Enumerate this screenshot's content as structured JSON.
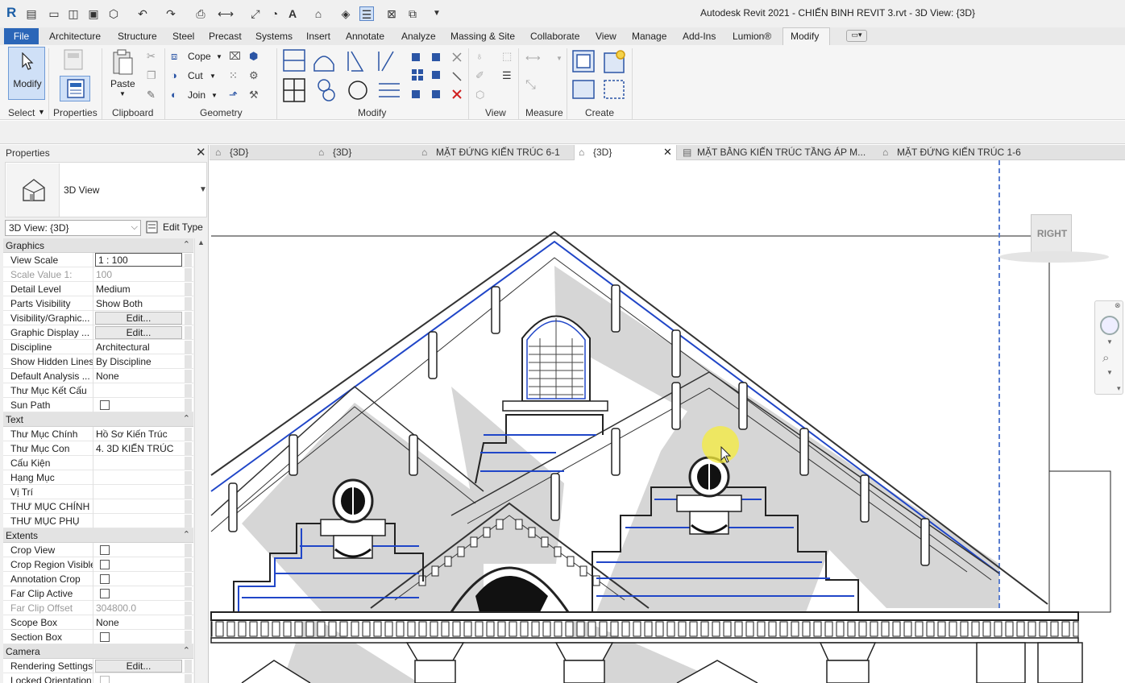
{
  "app": {
    "title": "Autodesk Revit 2021 - CHIẾN BINH REVIT 3.rvt - 3D View: {3D}",
    "logo": "R"
  },
  "quick_access": [
    "revit-logo",
    "open-icon",
    "new-icon",
    "folder-icon",
    "save-icon",
    "sync-icon",
    "undo-icon",
    "redo-icon",
    "print-icon",
    "measure-icon",
    "dimension-icon",
    "tag-icon",
    "text-icon",
    "3d-icon",
    "section-icon",
    "thin-lines-icon",
    "close-hidden-icon",
    "switch-windows-icon",
    "customize-icon"
  ],
  "menu": {
    "file": "File",
    "tabs": [
      "Architecture",
      "Structure",
      "Steel",
      "Precast",
      "Systems",
      "Insert",
      "Annotate",
      "Analyze",
      "Massing & Site",
      "Collaborate",
      "View",
      "Manage",
      "Add-Ins",
      "Lumion®",
      "Modify"
    ],
    "active": "Modify"
  },
  "ribbon": {
    "select": {
      "modify": "Modify",
      "label": "Select"
    },
    "properties": {
      "label": "Properties"
    },
    "clipboard": {
      "paste": "Paste",
      "label": "Clipboard"
    },
    "geometry": {
      "cope": "Cope",
      "cut": "Cut",
      "join": "Join",
      "label": "Geometry"
    },
    "modify": {
      "label": "Modify"
    },
    "view": {
      "label": "View"
    },
    "measure": {
      "label": "Measure"
    },
    "create": {
      "label": "Create"
    }
  },
  "properties": {
    "header": "Properties",
    "type_name": "3D View",
    "view_selector": "3D View: {3D}",
    "edit_type": "Edit Type",
    "categories": [
      {
        "name": "Graphics",
        "rows": [
          {
            "k": "View Scale",
            "v": "1 : 100",
            "kind": "input"
          },
          {
            "k": "Scale Value    1:",
            "v": "100",
            "kind": "disabled"
          },
          {
            "k": "Detail Level",
            "v": "Medium"
          },
          {
            "k": "Parts Visibility",
            "v": "Show Both"
          },
          {
            "k": "Visibility/Graphic...",
            "v": "Edit...",
            "kind": "button"
          },
          {
            "k": "Graphic Display ...",
            "v": "Edit...",
            "kind": "button"
          },
          {
            "k": "Discipline",
            "v": "Architectural"
          },
          {
            "k": "Show Hidden Lines",
            "v": "By Discipline"
          },
          {
            "k": "Default Analysis ...",
            "v": "None"
          },
          {
            "k": "Thư Mục Kết Cấu",
            "v": ""
          },
          {
            "k": "Sun Path",
            "v": "",
            "kind": "checkbox"
          }
        ]
      },
      {
        "name": "Text",
        "rows": [
          {
            "k": "Thư Mục Chính",
            "v": "Hồ Sơ Kiến Trúc"
          },
          {
            "k": "Thư Mục Con",
            "v": "4. 3D KIẾN TRÚC"
          },
          {
            "k": "Cấu Kiện",
            "v": ""
          },
          {
            "k": "Hạng Mục",
            "v": ""
          },
          {
            "k": "Vị Trí",
            "v": ""
          },
          {
            "k": "THƯ MỤC CHÍNH",
            "v": ""
          },
          {
            "k": "THƯ MỤC PHỤ",
            "v": ""
          }
        ]
      },
      {
        "name": "Extents",
        "rows": [
          {
            "k": "Crop View",
            "v": "",
            "kind": "checkbox"
          },
          {
            "k": "Crop Region Visible",
            "v": "",
            "kind": "checkbox"
          },
          {
            "k": "Annotation Crop",
            "v": "",
            "kind": "checkbox"
          },
          {
            "k": "Far Clip Active",
            "v": "",
            "kind": "checkbox"
          },
          {
            "k": "Far Clip Offset",
            "v": "304800.0",
            "kind": "disabled"
          },
          {
            "k": "Scope Box",
            "v": "None"
          },
          {
            "k": "Section Box",
            "v": "",
            "kind": "checkbox"
          }
        ]
      },
      {
        "name": "Camera",
        "rows": [
          {
            "k": "Rendering Settings",
            "v": "Edit...",
            "kind": "button"
          },
          {
            "k": "Locked Orientation",
            "v": "",
            "kind": "checkbox-disabled"
          }
        ]
      }
    ]
  },
  "view_tabs": [
    {
      "label": "{3D}",
      "icon": "3d-view-icon"
    },
    {
      "label": "{3D}",
      "icon": "3d-view-icon"
    },
    {
      "label": "MẶT ĐỨNG KIẾN TRÚC 6-1",
      "icon": "elevation-icon"
    },
    {
      "label": "{3D}",
      "icon": "3d-view-icon",
      "active": true
    },
    {
      "label": "MẶT BẰNG KIẾN TRÚC TẦNG ÁP M...",
      "icon": "floor-plan-icon"
    },
    {
      "label": "MẶT ĐỨNG KIẾN TRÚC 1-6",
      "icon": "elevation-icon"
    }
  ],
  "viewcube": {
    "face": "RIGHT"
  },
  "colors": {
    "accent": "#2b66b8",
    "selection_blue": "#2046c8",
    "shadow": "#d4d4d4"
  }
}
